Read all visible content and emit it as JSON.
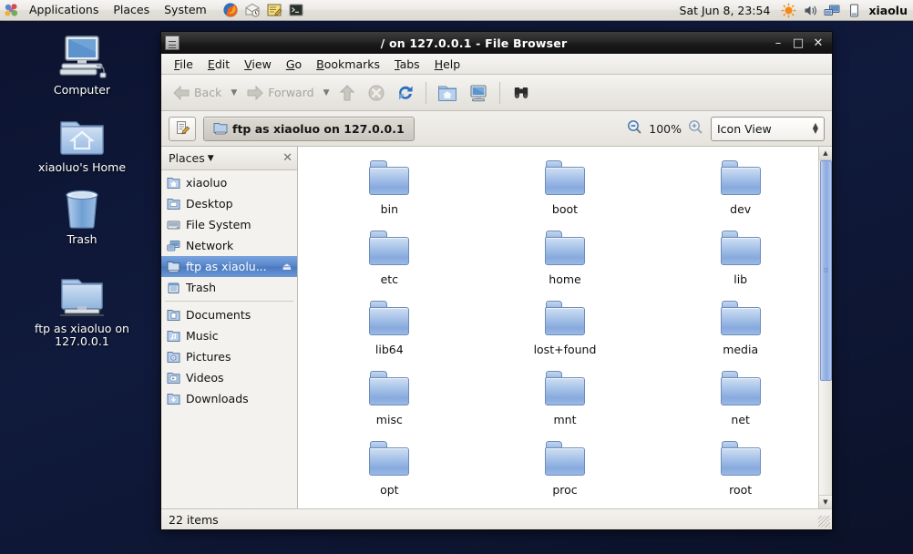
{
  "panel": {
    "menus": [
      "Applications",
      "Places",
      "System"
    ],
    "launchers": [
      "firefox-icon",
      "evolution-mail-icon",
      "text-editor-icon",
      "terminal-icon"
    ],
    "clock": "Sat Jun  8, 23:54",
    "tray": [
      "brightness-icon",
      "volume-icon",
      "network-icon",
      "battery-icon"
    ],
    "username": "xiaolu"
  },
  "desktop": {
    "icons": [
      {
        "name": "Computer",
        "icon": "computer-icon"
      },
      {
        "name": "xiaoluo's Home",
        "icon": "home-folder-icon"
      },
      {
        "name": "Trash",
        "icon": "trash-icon"
      },
      {
        "name": "ftp as xiaoluo on 127.0.0.1",
        "icon": "remote-server-icon"
      }
    ]
  },
  "window": {
    "title": "/ on 127.0.0.1 - File Browser",
    "controls": {
      "minimize": "–",
      "maximize": "□",
      "close": "✕"
    },
    "menubar": [
      {
        "mnemonic": "F",
        "rest": "ile"
      },
      {
        "mnemonic": "E",
        "rest": "dit"
      },
      {
        "mnemonic": "V",
        "rest": "iew"
      },
      {
        "mnemonic": "G",
        "rest": "o"
      },
      {
        "mnemonic": "B",
        "rest": "ookmarks"
      },
      {
        "mnemonic": "T",
        "rest": "abs"
      },
      {
        "mnemonic": "H",
        "rest": "elp"
      }
    ],
    "toolbar": {
      "back": "Back",
      "forward": "Forward",
      "up": "up-icon",
      "stop": "stop-icon",
      "reload": "reload-icon",
      "home": "home-icon",
      "computer": "computer-icon",
      "search": "search-binoculars-icon"
    },
    "location": {
      "edit_toggle": "edit-location-icon",
      "breadcrumb": "ftp as xiaoluo on 127.0.0.1",
      "zoom_out": "zoom-out-icon",
      "zoom_level": "100%",
      "zoom_in": "zoom-in-icon",
      "view_mode": "Icon View"
    },
    "sidebar": {
      "header": "Places",
      "close": "✕",
      "items": [
        {
          "label": "xiaoluo",
          "icon": "home-folder-icon",
          "selected": false
        },
        {
          "label": "Desktop",
          "icon": "desktop-folder-icon",
          "selected": false
        },
        {
          "label": "File System",
          "icon": "drive-harddisk-icon",
          "selected": false
        },
        {
          "label": "Network",
          "icon": "network-icon",
          "selected": false
        },
        {
          "label": "ftp as xiaolu...",
          "icon": "remote-server-icon",
          "selected": true,
          "eject": "⏏"
        },
        {
          "label": "Trash",
          "icon": "trash-icon",
          "selected": false
        },
        {
          "separator": true
        },
        {
          "label": "Documents",
          "icon": "folder-documents-icon",
          "selected": false
        },
        {
          "label": "Music",
          "icon": "folder-music-icon",
          "selected": false
        },
        {
          "label": "Pictures",
          "icon": "folder-pictures-icon",
          "selected": false
        },
        {
          "label": "Videos",
          "icon": "folder-videos-icon",
          "selected": false
        },
        {
          "label": "Downloads",
          "icon": "folder-downloads-icon",
          "selected": false
        }
      ]
    },
    "files": [
      "bin",
      "boot",
      "dev",
      "etc",
      "home",
      "lib",
      "lib64",
      "lost+found",
      "media",
      "misc",
      "mnt",
      "net",
      "opt",
      "proc",
      "root"
    ],
    "scrollbar": {
      "up": "▲",
      "down": "▼",
      "thumb_fraction": 0.66
    },
    "statusbar": "22 items"
  },
  "colors": {
    "desktop_bg": "#0d1530",
    "selection_blue": "#5684c8",
    "titlebar_dark": "#1a1a1a",
    "panel_bg": "#eceae6"
  }
}
